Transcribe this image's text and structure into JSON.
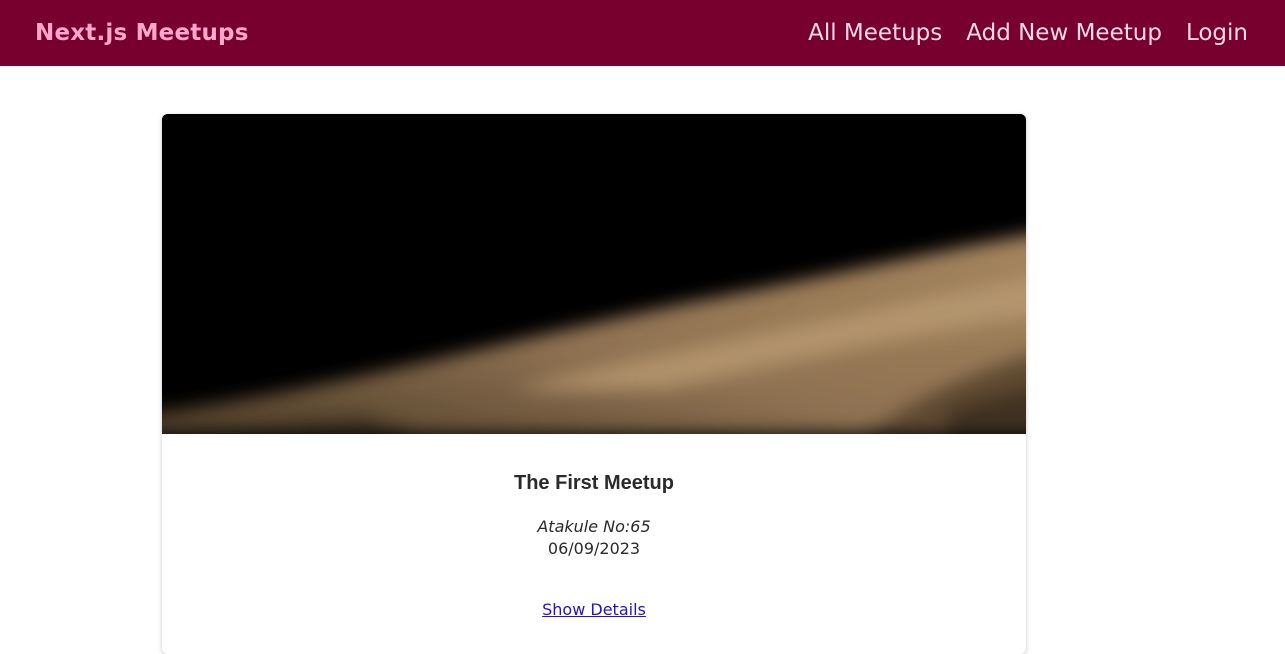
{
  "header": {
    "logo": "Next.js Meetups",
    "nav": [
      {
        "label": "All Meetups"
      },
      {
        "label": "Add New Meetup"
      },
      {
        "label": "Login"
      }
    ],
    "background_color": "#77002e",
    "logo_color": "#fca7cb"
  },
  "meetup": {
    "image": "blurry-photo-of-tan-surface-against-black",
    "title": "The First Meetup",
    "address": "Atakule No:65",
    "date": "06/09/2023",
    "details_link": "Show Details"
  }
}
